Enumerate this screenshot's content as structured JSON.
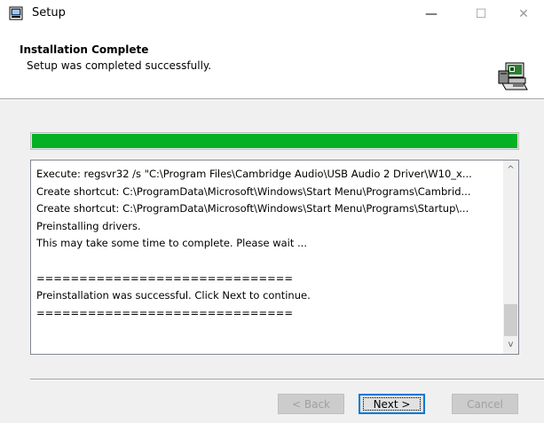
{
  "window": {
    "title": "Setup",
    "controls": {
      "minimize": "—",
      "maximize": "☐",
      "close": "✕"
    }
  },
  "header": {
    "title": "Installation Complete",
    "subtitle": "Setup was completed successfully."
  },
  "progress": {
    "fraction": 1.0,
    "color": "#06b025"
  },
  "log": {
    "lines": [
      "Execute: regsvr32 /s \"C:\\Program Files\\Cambridge Audio\\USB Audio 2 Driver\\W10_x...",
      "Create shortcut: C:\\ProgramData\\Microsoft\\Windows\\Start Menu\\Programs\\Cambrid...",
      "Create shortcut: C:\\ProgramData\\Microsoft\\Windows\\Start Menu\\Programs\\Startup\\...",
      "Preinstalling drivers.",
      "This may take some time to complete. Please wait ...",
      "",
      "==============================",
      "Preinstallation was successful. Click Next to continue.",
      "=============================="
    ],
    "scroll_up": "^",
    "scroll_down": "v"
  },
  "buttons": {
    "back": {
      "label": "< Back",
      "mnemonic": "B",
      "enabled": false
    },
    "next": {
      "label": "Next >",
      "mnemonic": "N",
      "enabled": true
    },
    "cancel": {
      "label": "Cancel",
      "enabled": false
    }
  },
  "icons": {
    "app": "setup-app-icon",
    "header": "computer-installer-icon"
  }
}
